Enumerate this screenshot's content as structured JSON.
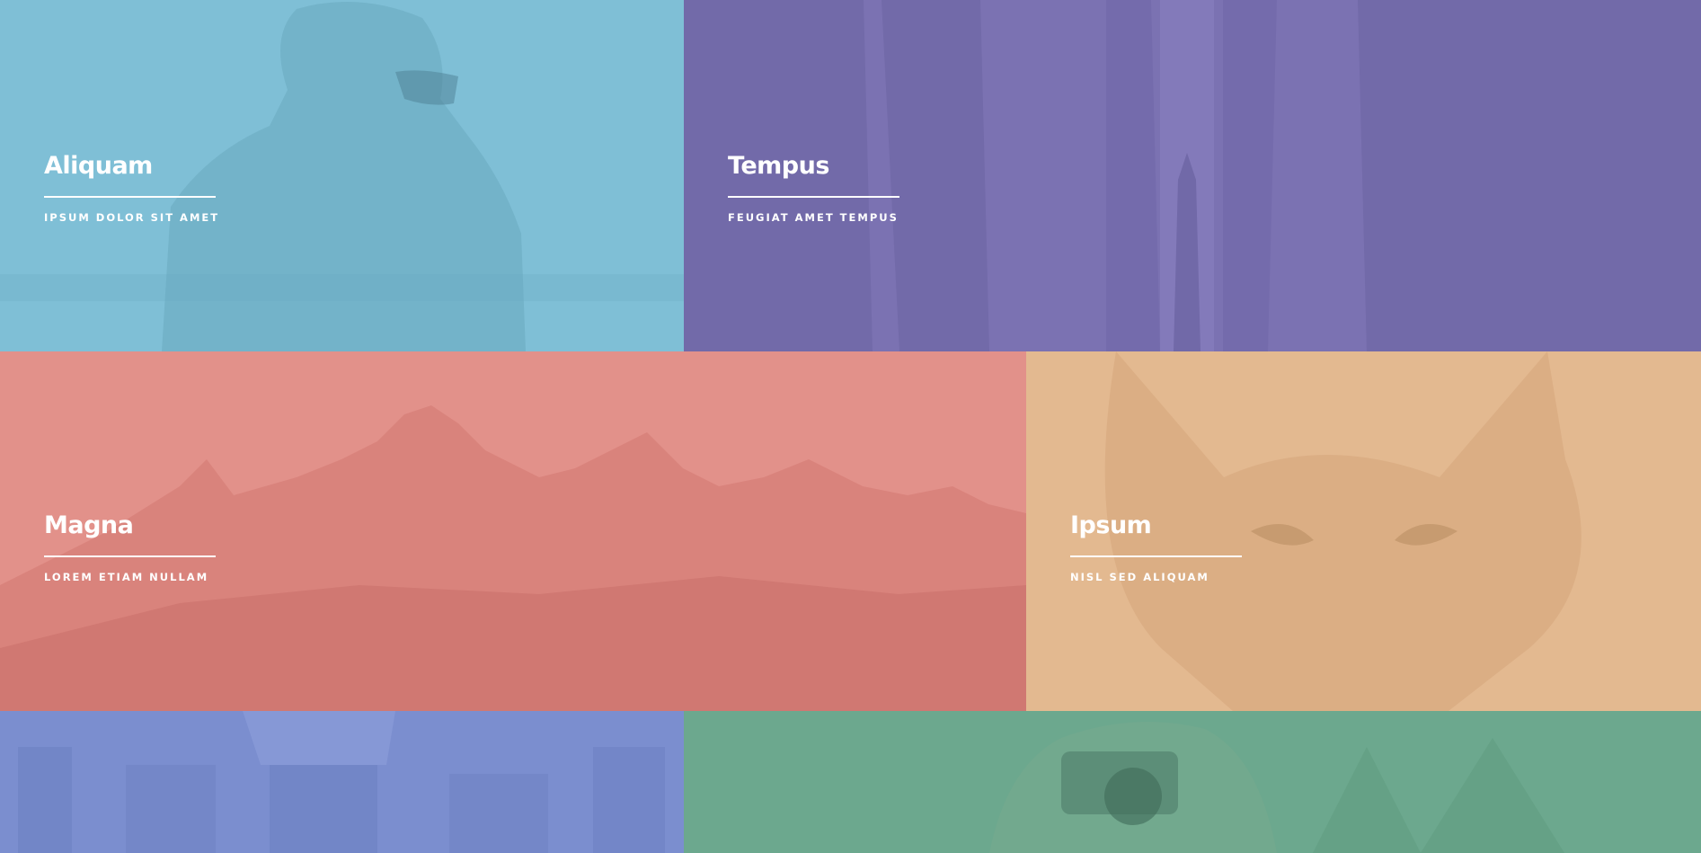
{
  "tiles": [
    {
      "title": "Aliquam",
      "subtitle": "IPSUM DOLOR SIT AMET",
      "color": "#7fbfd6",
      "image": "person-portrait"
    },
    {
      "title": "Tempus",
      "subtitle": "FEUGIAT AMET TEMPUS",
      "color": "#7b72b2",
      "image": "city-buildings"
    },
    {
      "title": "Magna",
      "subtitle": "LOREM ETIAM NULLAM",
      "color": "#e2918a",
      "image": "mountain-range"
    },
    {
      "title": "Ipsum",
      "subtitle": "NISL SED ALIQUAM",
      "color": "#e3b990",
      "image": "fox-face"
    },
    {
      "title": "",
      "subtitle": "",
      "color": "#7b8ecf",
      "image": "train-station"
    },
    {
      "title": "",
      "subtitle": "",
      "color": "#6ca88e",
      "image": "camera-photographer"
    }
  ]
}
